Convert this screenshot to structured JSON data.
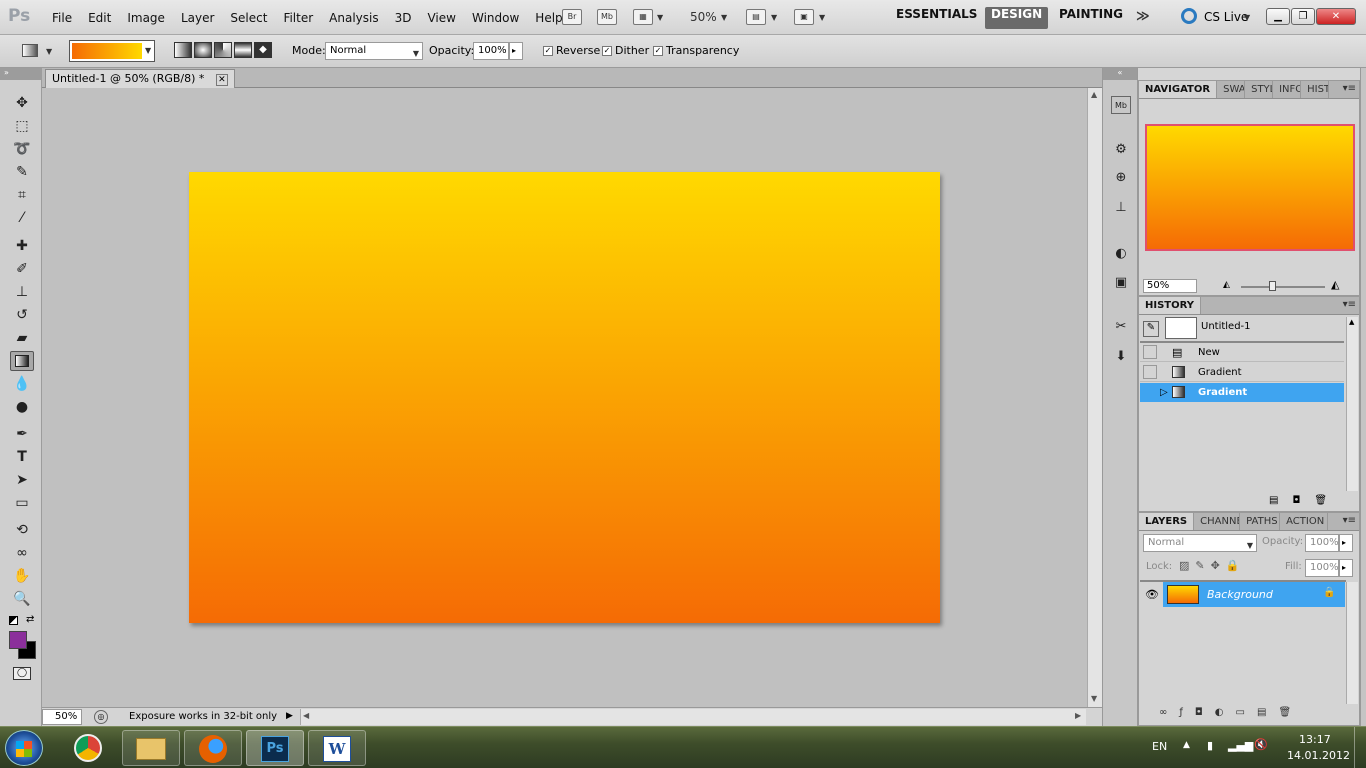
{
  "app": {
    "logo": "Ps"
  },
  "menu": [
    "File",
    "Edit",
    "Image",
    "Layer",
    "Select",
    "Filter",
    "Analysis",
    "3D",
    "View",
    "Window",
    "Help"
  ],
  "appbar": {
    "bridge": "Br",
    "minibridge": "Mb",
    "zoom": "50%"
  },
  "workspaces": [
    "ESSENTIALS",
    "DESIGN",
    "PAINTING"
  ],
  "cslive": "CS Live",
  "options": {
    "mode_label": "Mode:",
    "mode_value": "Normal",
    "opacity_label": "Opacity:",
    "opacity_value": "100%",
    "reverse": "Reverse",
    "dither": "Dither",
    "transparency": "Transparency"
  },
  "document": {
    "tab_title": "Untitled-1 @ 50% (RGB/8) *",
    "gradient_top": "#ffd900",
    "gradient_bottom": "#f56b05"
  },
  "status": {
    "zoom": "50%",
    "message": "Exposure works in 32-bit only"
  },
  "colors": {
    "foreground": "#8b2f9b",
    "background": "#000000",
    "selection": "#3fa4f0"
  },
  "navigator": {
    "tabs": [
      "NAVIGATOR",
      "SWA",
      "STYL",
      "INFO",
      "HIST"
    ],
    "zoom": "50%"
  },
  "history": {
    "tab": "HISTORY",
    "snapshot": "Untitled-1",
    "items": [
      "New",
      "Gradient",
      "Gradient"
    ],
    "active_index": 2
  },
  "layers": {
    "tabs": [
      "LAYERS",
      "CHANNE",
      "PATHS",
      "ACTION"
    ],
    "blend": "Normal",
    "opacity_label": "Opacity:",
    "opacity": "100%",
    "lock_label": "Lock:",
    "fill_label": "Fill:",
    "fill": "100%",
    "layer_name": "Background"
  },
  "tray": {
    "lang": "EN",
    "time": "13:17",
    "date": "14.01.2012"
  }
}
